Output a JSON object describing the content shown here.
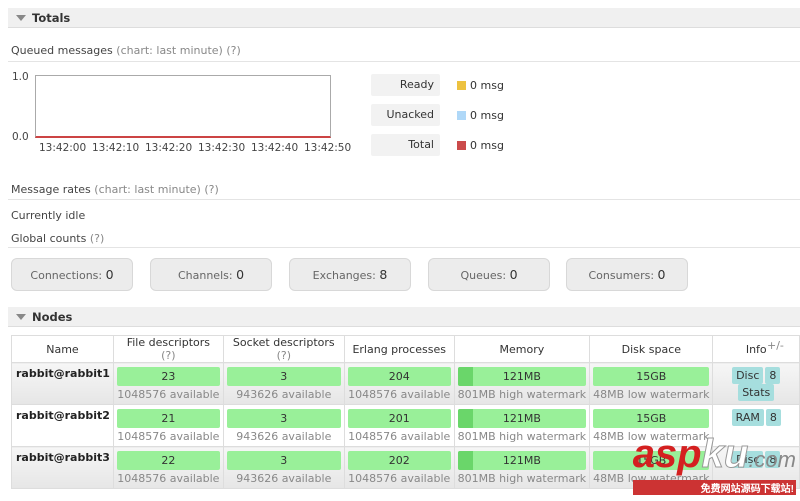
{
  "totals": {
    "title": "Totals",
    "queued": {
      "label": "Queued messages",
      "note": "(chart: last minute)",
      "help": "(?)",
      "y_ticks": [
        "1.0",
        "0.0"
      ],
      "x_ticks": [
        "13:42:00",
        "13:42:10",
        "13:42:20",
        "13:42:30",
        "13:42:40",
        "13:42:50"
      ],
      "legend": [
        {
          "label": "Ready",
          "value": "0 msg",
          "color": "#edc240"
        },
        {
          "label": "Unacked",
          "value": "0 msg",
          "color": "#afd8f8"
        },
        {
          "label": "Total",
          "value": "0 msg",
          "color": "#cb4b4b"
        }
      ]
    },
    "rates": {
      "label": "Message rates",
      "note": "(chart: last minute)",
      "help": "(?)",
      "status": "Currently idle"
    },
    "global": {
      "label": "Global counts",
      "help": "(?)",
      "counts": [
        {
          "label": "Connections:",
          "value": "0"
        },
        {
          "label": "Channels:",
          "value": "0"
        },
        {
          "label": "Exchanges:",
          "value": "8"
        },
        {
          "label": "Queues:",
          "value": "0"
        },
        {
          "label": "Consumers:",
          "value": "0"
        }
      ]
    }
  },
  "nodes": {
    "title": "Nodes",
    "toggle": "+/-",
    "headers": {
      "name": "Name",
      "fd": "File descriptors",
      "sd": "Socket descriptors",
      "help": "(?)",
      "ep": "Erlang processes",
      "mem": "Memory",
      "disk": "Disk space",
      "info": "Info"
    },
    "rows": [
      {
        "name": "rabbit@rabbit1",
        "fd": "23",
        "fd_avail": "1048576 available",
        "sd": "3",
        "sd_avail": "943626 available",
        "ep": "204",
        "ep_avail": "1048576 available",
        "mem": "121MB",
        "mem_sub": "801MB high watermark",
        "disk": "15GB",
        "disk_sub": "48MB low watermark",
        "tags": [
          "Disc",
          "8",
          "Stats"
        ]
      },
      {
        "name": "rabbit@rabbit2",
        "fd": "21",
        "fd_avail": "1048576 available",
        "sd": "3",
        "sd_avail": "943626 available",
        "ep": "201",
        "ep_avail": "1048576 available",
        "mem": "121MB",
        "mem_sub": "801MB high watermark",
        "disk": "15GB",
        "disk_sub": "48MB low watermark",
        "tags": [
          "RAM",
          "8"
        ]
      },
      {
        "name": "rabbit@rabbit3",
        "fd": "22",
        "fd_avail": "1048576 available",
        "sd": "3",
        "sd_avail": "943626 available",
        "ep": "202",
        "ep_avail": "1048576 available",
        "mem": "121MB",
        "mem_sub": "801MB high watermark",
        "disk": "15GB",
        "disk_sub": "48MB low watermark",
        "tags": [
          "Disc",
          "8"
        ]
      }
    ]
  },
  "watermark": {
    "text": "aspku.com",
    "sub": "免费网站源码下载站!"
  }
}
